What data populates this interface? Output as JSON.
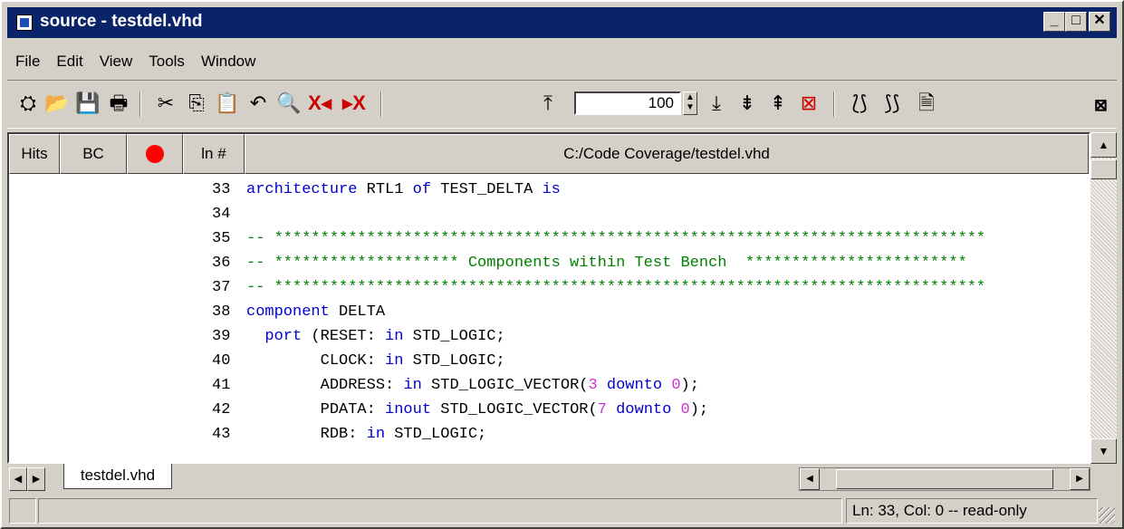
{
  "window": {
    "title": "source - testdel.vhd"
  },
  "menu": [
    "File",
    "Edit",
    "View",
    "Tools",
    "Window"
  ],
  "toolbar": {
    "zoom_value": "100"
  },
  "columns": {
    "hits": "Hits",
    "bc": "BC",
    "line_number": "ln #",
    "file_path": "C:/Code Coverage/testdel.vhd"
  },
  "code_lines": [
    {
      "num": "33",
      "segments": [
        [
          "k",
          "architecture"
        ],
        [
          "t",
          " RTL1 "
        ],
        [
          "k",
          "of"
        ],
        [
          "t",
          " TEST_DELTA "
        ],
        [
          "k",
          "is"
        ]
      ]
    },
    {
      "num": "34",
      "segments": []
    },
    {
      "num": "35",
      "segments": [
        [
          "c",
          "-- *****************************************************************************"
        ]
      ]
    },
    {
      "num": "36",
      "segments": [
        [
          "c",
          "-- ******************** Components within Test Bench  ************************"
        ]
      ]
    },
    {
      "num": "37",
      "segments": [
        [
          "c",
          "-- *****************************************************************************"
        ]
      ]
    },
    {
      "num": "38",
      "segments": [
        [
          "k",
          "component"
        ],
        [
          "t",
          " DELTA"
        ]
      ]
    },
    {
      "num": "39",
      "segments": [
        [
          "t",
          "  "
        ],
        [
          "k",
          "port"
        ],
        [
          "t",
          " (RESET: "
        ],
        [
          "k",
          "in"
        ],
        [
          "t",
          " STD_LOGIC;"
        ]
      ]
    },
    {
      "num": "40",
      "segments": [
        [
          "t",
          "        CLOCK: "
        ],
        [
          "k",
          "in"
        ],
        [
          "t",
          " STD_LOGIC;"
        ]
      ]
    },
    {
      "num": "41",
      "segments": [
        [
          "t",
          "        ADDRESS: "
        ],
        [
          "k",
          "in"
        ],
        [
          "t",
          " STD_LOGIC_VECTOR("
        ],
        [
          "n",
          "3"
        ],
        [
          "t",
          " "
        ],
        [
          "k",
          "downto"
        ],
        [
          "t",
          " "
        ],
        [
          "n",
          "0"
        ],
        [
          "t",
          ");"
        ]
      ]
    },
    {
      "num": "42",
      "segments": [
        [
          "t",
          "        PDATA: "
        ],
        [
          "k",
          "inout"
        ],
        [
          "t",
          " STD_LOGIC_VECTOR("
        ],
        [
          "n",
          "7"
        ],
        [
          "t",
          " "
        ],
        [
          "k",
          "downto"
        ],
        [
          "t",
          " "
        ],
        [
          "n",
          "0"
        ],
        [
          "t",
          ");"
        ]
      ]
    },
    {
      "num": "43",
      "segments": [
        [
          "t",
          "        RDB: "
        ],
        [
          "k",
          "in"
        ],
        [
          "t",
          " STD_LOGIC;"
        ]
      ]
    }
  ],
  "tabs": [
    "testdel.vhd"
  ],
  "status": {
    "position": "Ln:  33, Col:  0  -- read-only"
  },
  "colors": {
    "titlebar": "#0a246a",
    "keyword": "#0000cc",
    "comment": "#008000",
    "number": "#cc33cc",
    "chrome": "#d4d0c8"
  },
  "icons": [
    "step-icon",
    "open-folder-icon",
    "save-icon",
    "print-icon",
    "cut-icon",
    "copy-icon",
    "paste-icon",
    "undo-icon",
    "find-icon",
    "clear-left-icon",
    "clear-right-icon",
    "top-icon",
    "bottom-icon",
    "next-icon",
    "prev-icon",
    "clear-icon",
    "step-into-icon",
    "step-over-icon",
    "document-icon"
  ]
}
